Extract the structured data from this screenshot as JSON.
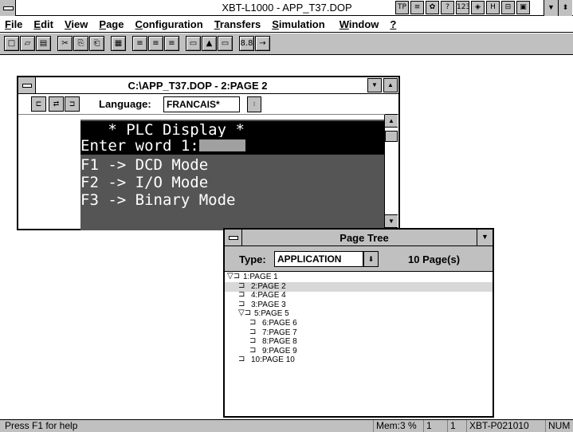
{
  "app": {
    "title": "XBT-L1000 - APP_T37.DOP",
    "title_icons": [
      "TP",
      "≡",
      "✿",
      "?",
      "123",
      "◈",
      "H",
      "⊟",
      "▣"
    ]
  },
  "menu": [
    "File",
    "Edit",
    "View",
    "Page",
    "Configuration",
    "Transfers",
    "Simulation",
    "Window",
    "?"
  ],
  "menu_underline": [
    "F",
    "E",
    "V",
    "P",
    "C",
    "T",
    "S",
    "W",
    "?"
  ],
  "toolbar": [
    "new",
    "open",
    "save",
    "cut",
    "copy",
    "paste",
    "delete",
    "align-left",
    "align-center",
    "align-right",
    "rect",
    "alarm",
    "field",
    "number",
    "link"
  ],
  "toolbar_glyphs": [
    "□",
    "▱",
    "▤",
    "✂",
    "⎘",
    "⎗",
    "▦",
    "≡",
    "≡",
    "≡",
    "▭",
    "▲",
    "▭",
    "8.8",
    "→"
  ],
  "page_window": {
    "title": "C:\\APP_T37.DOP - 2:PAGE 2",
    "language_label": "Language:",
    "language_value": "FRANCAIS*",
    "screen_lines": [
      "   * PLC Display *",
      "Enter word 1:",
      "F1 -> DCD Mode",
      "F2 -> I/O Mode",
      "F3 -> Binary Mode"
    ]
  },
  "page_tree": {
    "title": "Page Tree",
    "type_label": "Type:",
    "type_value": "APPLICATION",
    "page_count": "10 Page(s)",
    "items": [
      {
        "label": "1:PAGE 1",
        "level": 0,
        "icon": "▽⊐"
      },
      {
        "label": "2:PAGE 2",
        "level": 1,
        "icon": "⊐",
        "selected": true
      },
      {
        "label": "4:PAGE 4",
        "level": 1,
        "icon": "⊐"
      },
      {
        "label": "3:PAGE 3",
        "level": 1,
        "icon": "⊐"
      },
      {
        "label": "5:PAGE 5",
        "level": 1,
        "icon": "▽⊐"
      },
      {
        "label": "6:PAGE 6",
        "level": 2,
        "icon": "⊐"
      },
      {
        "label": "7:PAGE 7",
        "level": 2,
        "icon": "⊐"
      },
      {
        "label": "8:PAGE 8",
        "level": 2,
        "icon": "⊐"
      },
      {
        "label": "9:PAGE 9",
        "level": 2,
        "icon": "⊐"
      },
      {
        "label": "10:PAGE 10",
        "level": 1,
        "icon": "⊐"
      }
    ]
  },
  "status": {
    "help": "Press F1 for help",
    "mem": "Mem:3 %",
    "field1": "1",
    "field2": "1",
    "terminal": "XBT-P021010",
    "num": "NUM"
  }
}
